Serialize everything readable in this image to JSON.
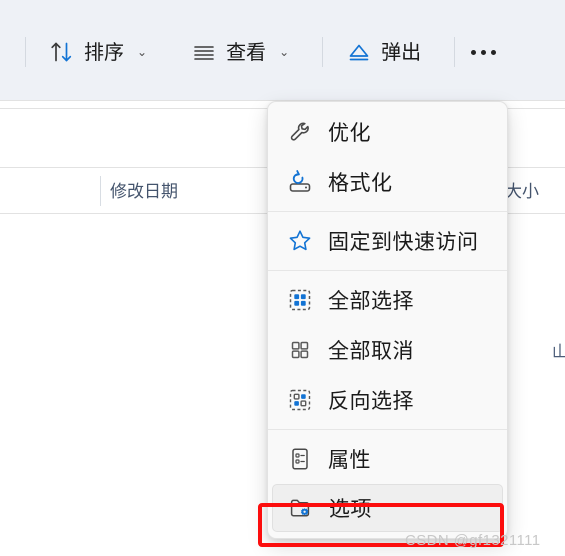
{
  "toolbar": {
    "items": [
      {
        "label": "排序",
        "icon": "sort-arrows-icon",
        "chevron": "⌄",
        "name": "sort"
      },
      {
        "label": "查看",
        "icon": "view-lines-icon",
        "chevron": "⌄",
        "name": "view"
      },
      {
        "label": "弹出",
        "icon": "eject-icon",
        "chevron": "",
        "name": "eject"
      }
    ],
    "overflow": {
      "label": "",
      "icon": "more-dots-icon",
      "name": "more"
    }
  },
  "file_list": {
    "columns": [
      {
        "label": "修改日期",
        "name": "date-modified"
      },
      {
        "label": "大小",
        "name": "size"
      }
    ],
    "partial_glyph": "山"
  },
  "context_menu": {
    "groups": [
      {
        "items": [
          {
            "label": "优化",
            "icon": "wrench-icon",
            "selected": false
          },
          {
            "label": "格式化",
            "icon": "format-drive-icon",
            "selected": false
          }
        ]
      },
      {
        "items": [
          {
            "label": "固定到快速访问",
            "icon": "star-icon",
            "selected": false
          }
        ]
      },
      {
        "items": [
          {
            "label": "全部选择",
            "icon": "select-all-icon",
            "selected": false
          },
          {
            "label": "全部取消",
            "icon": "select-none-icon",
            "selected": false
          },
          {
            "label": "反向选择",
            "icon": "invert-selection-icon",
            "selected": false
          }
        ]
      },
      {
        "items": [
          {
            "label": "属性",
            "icon": "properties-icon",
            "selected": false
          },
          {
            "label": "选项",
            "icon": "folder-options-icon",
            "selected": true
          }
        ]
      }
    ]
  },
  "annotation": {
    "highlight_color": "#fc0d0d",
    "target_label": "选项"
  },
  "watermark": {
    "text": "CSDN @gf1321111"
  },
  "colors": {
    "toolbar_bg": "#eef1f6",
    "menu_bg": "#f9f9f9",
    "accent_blue": "#0f6cbd",
    "text": "#1a1a1a",
    "column_header_text": "#44546d"
  }
}
